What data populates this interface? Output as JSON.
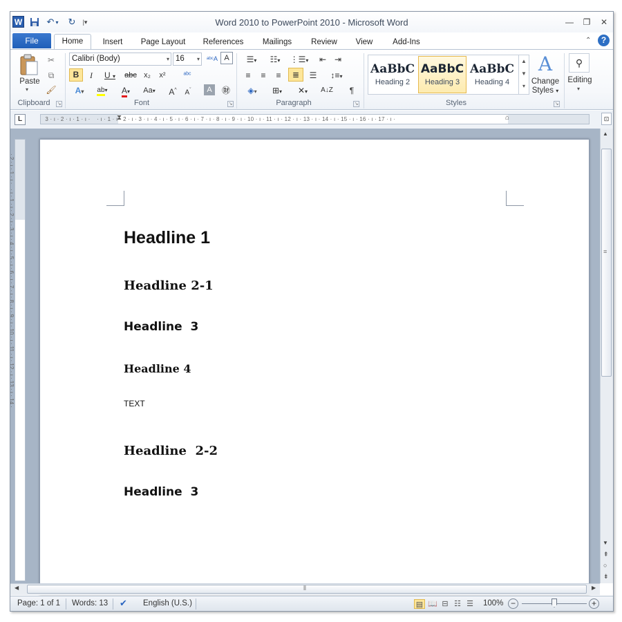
{
  "window": {
    "title": "Word 2010 to PowerPoint 2010  -  Microsoft Word",
    "app_icon": "W",
    "controls": {
      "minimize": "—",
      "restore": "❐",
      "close": "✕"
    }
  },
  "tabs": [
    "File",
    "Home",
    "Insert",
    "Page Layout",
    "References",
    "Mailings",
    "Review",
    "View",
    "Add-Ins"
  ],
  "ribbon": {
    "clipboard": {
      "label": "Clipboard",
      "paste": "Paste"
    },
    "font": {
      "label": "Font",
      "font_name": "Calibri (Body)",
      "font_size": "16"
    },
    "paragraph": {
      "label": "Paragraph"
    },
    "styles": {
      "label": "Styles",
      "items": [
        {
          "sample": "AaBbC",
          "name": "Heading 2"
        },
        {
          "sample": "AaBbC",
          "name": "Heading 3"
        },
        {
          "sample": "AaBbC",
          "name": "Heading 4"
        }
      ],
      "change_styles_line1": "Change",
      "change_styles_line2": "Styles"
    },
    "editing": {
      "label": "Editing"
    }
  },
  "document": {
    "lines": [
      "Headline 1",
      "Headline 2-1",
      "Headline  3",
      "Headline 4",
      "TEXT",
      "Headline  2-2",
      "Headline  3"
    ]
  },
  "status": {
    "page": "Page: 1 of 1",
    "words": "Words: 13",
    "language": "English (U.S.)",
    "zoom": "100%"
  },
  "colors": {
    "accent": "#2a65c0",
    "selected_style_border": "#e6b94e",
    "workspace": "#a7b5c6"
  }
}
